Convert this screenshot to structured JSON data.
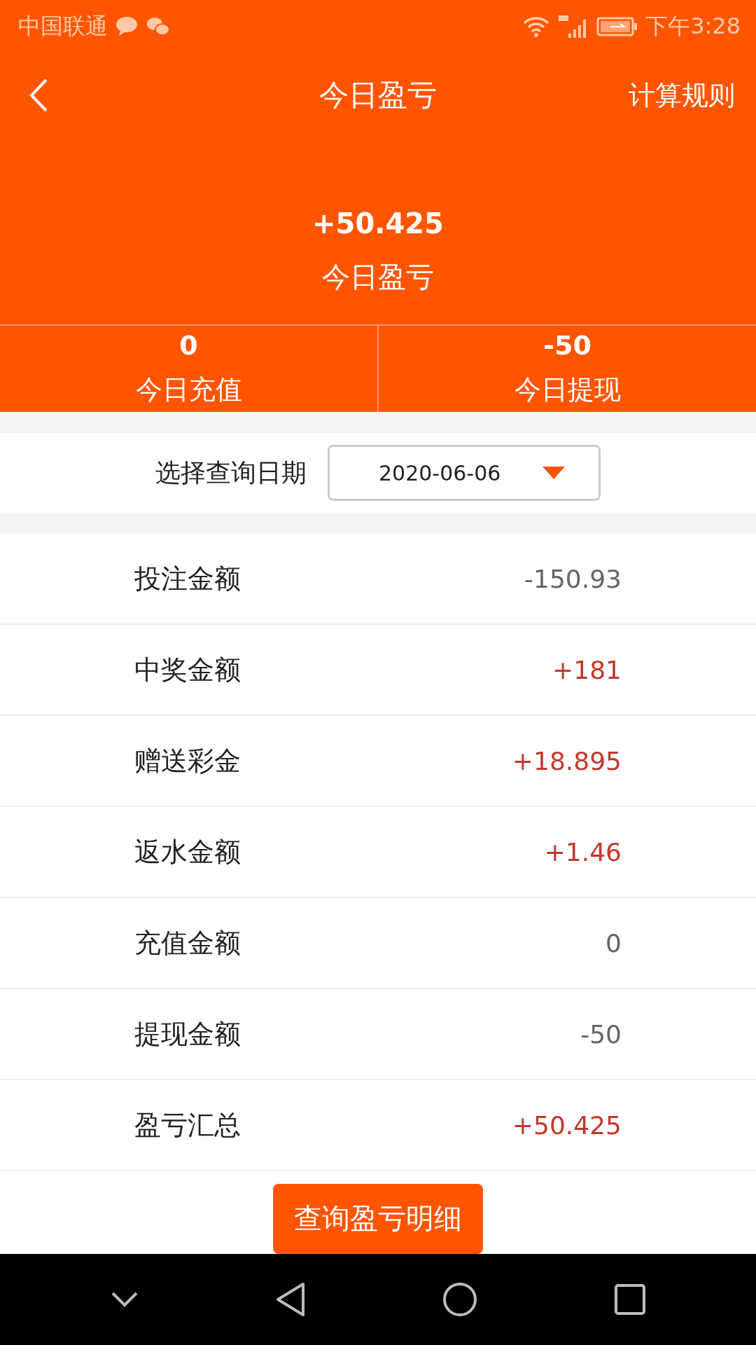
{
  "status_bar": {
    "carrier": "中国联通",
    "time": "下午3:28"
  },
  "header": {
    "title": "今日盈亏",
    "action": "计算规则"
  },
  "summary": {
    "value": "+50.425",
    "label": "今日盈亏"
  },
  "stats": [
    {
      "value": "0",
      "label": "今日充值"
    },
    {
      "value": "-50",
      "label": "今日提现"
    }
  ],
  "date_filter": {
    "label": "选择查询日期",
    "value": "2020-06-06"
  },
  "rows": [
    {
      "label": "投注金额",
      "value": "-150.93",
      "color": "#666666"
    },
    {
      "label": "中奖金额",
      "value": "+181",
      "color": "#c0392b"
    },
    {
      "label": "赠送彩金",
      "value": "+18.895",
      "color": "#c0392b"
    },
    {
      "label": "返水金额",
      "value": "+1.46",
      "color": "#c0392b"
    },
    {
      "label": "充值金额",
      "value": "0",
      "color": "#666666"
    },
    {
      "label": "提现金额",
      "value": "-50",
      "color": "#666666"
    },
    {
      "label": "盈亏汇总",
      "value": "+50.425",
      "color": "#c0392b"
    }
  ],
  "detail_button": "查询盈亏明细"
}
